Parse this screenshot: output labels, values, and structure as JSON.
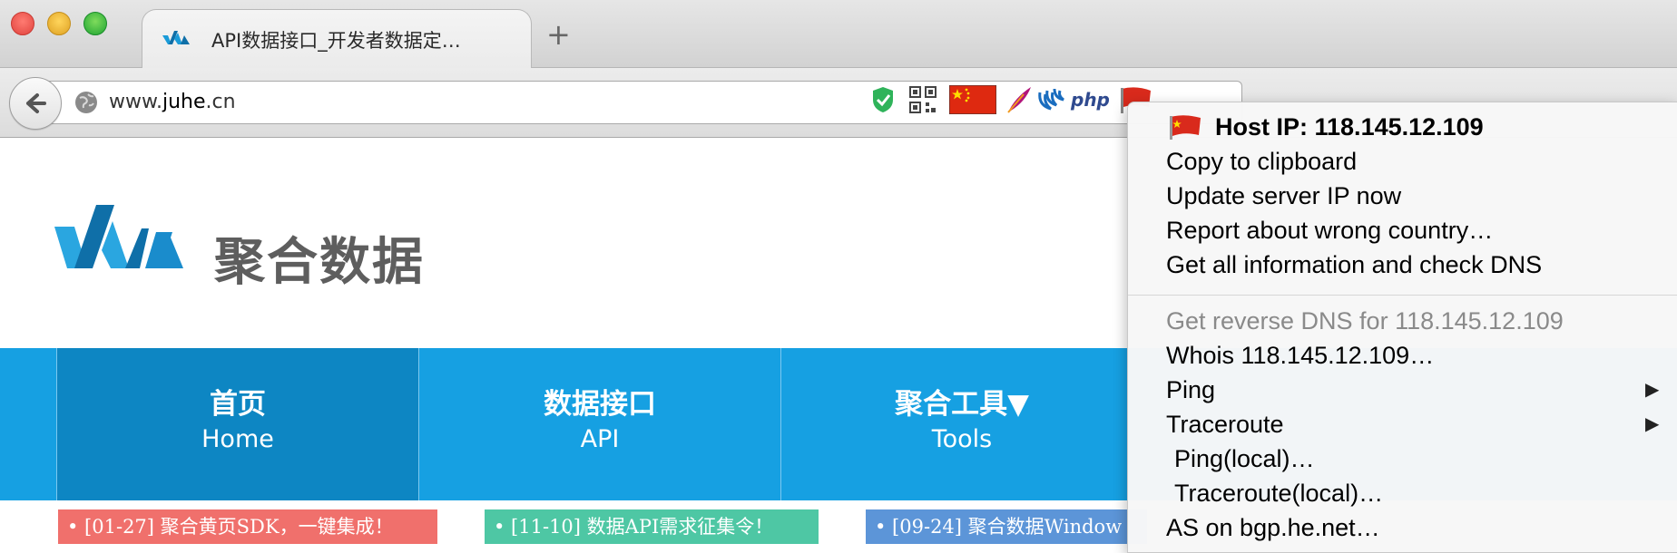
{
  "browser": {
    "tab_title": "API数据接口_开发者数据定…",
    "new_tab_symbol": "+",
    "url_prefix": "www.",
    "url_domain": "juhe",
    "url_suffix": ".cn",
    "ext_php_label": "php"
  },
  "site": {
    "logo_text": "聚合数据",
    "nav": [
      {
        "zh": "首页",
        "en": "Home"
      },
      {
        "zh": "数据接口",
        "en": "API"
      },
      {
        "zh": "聚合工具▼",
        "en": "Tools"
      }
    ],
    "news": [
      "• [01-27] 聚合黄页SDK，一键集成！",
      "• [11-10] 数据API需求征集令！",
      "• [09-24] 聚合数据Window"
    ]
  },
  "context_menu": {
    "host_ip": "Host IP: 118.145.12.109",
    "items_top": [
      "Copy to clipboard",
      "Update server IP now",
      "Report about wrong country…",
      "Get all information and check DNS"
    ],
    "reverse_dns": "Get reverse DNS for 118.145.12.109",
    "whois": "Whois 118.145.12.109…",
    "ping": "Ping",
    "traceroute": "Traceroute",
    "submenu_arrow": "▶",
    "ping_local": "Ping(local)…",
    "traceroute_local": "Traceroute(local)…",
    "as_lookup": "AS on bgp.he.net…"
  },
  "colors": {
    "nav_blue": "#16a0e2",
    "nav_active": "#0d86c3",
    "news_red": "#f0706c",
    "news_green": "#4ec7a4",
    "news_blue": "#5c95d8"
  }
}
